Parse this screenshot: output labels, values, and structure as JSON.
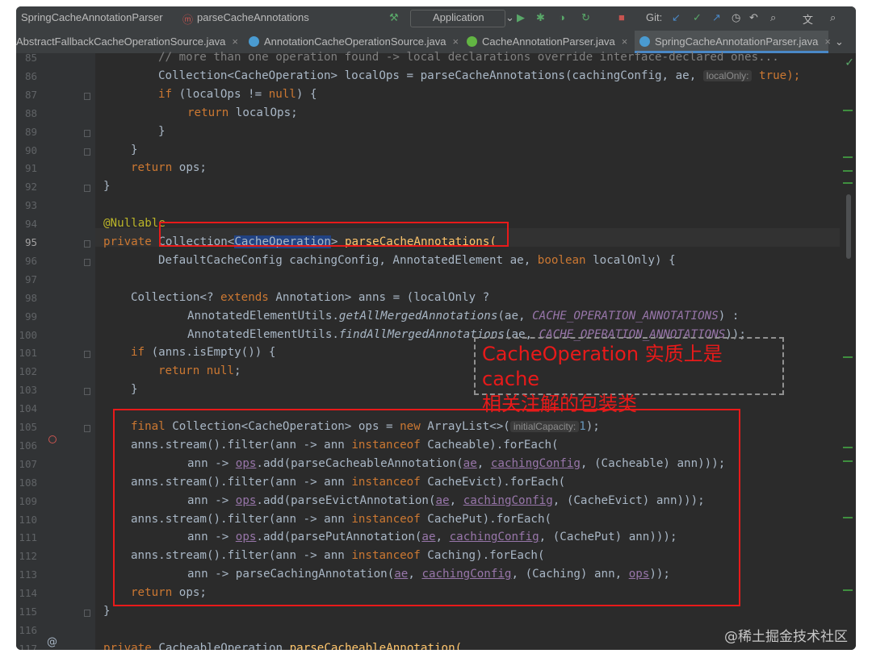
{
  "navbar": {
    "breadcrumb_file": "SpringCacheAnnotationParser",
    "breadcrumb_method": "parseCacheAnnotations",
    "run_config": "Application",
    "git_label": "Git:"
  },
  "tabs": [
    {
      "label": "AbstractFallbackCacheOperationSource.java",
      "close": "×"
    },
    {
      "label": "AnnotationCacheOperationSource.java",
      "close": "×"
    },
    {
      "label": "CacheAnnotationParser.java",
      "close": "×"
    },
    {
      "label": "SpringCacheAnnotationParser.java",
      "close": "×"
    }
  ],
  "line_numbers": [
    "85",
    "86",
    "87",
    "88",
    "89",
    "90",
    "91",
    "92",
    "93",
    "94",
    "95",
    "96",
    "97",
    "98",
    "99",
    "100",
    "101",
    "102",
    "103",
    "104",
    "105",
    "106",
    "107",
    "108",
    "109",
    "110",
    "111",
    "112",
    "113",
    "114",
    "115",
    "116",
    "117"
  ],
  "code": {
    "l85": "// more than one operation found -> local declarations override interface-declared ones...",
    "l86": "Collection<CacheOperation> localOps = parseCacheAnnotations(cachingConfig, ae,",
    "l86_hint": "localOnly:",
    "l86_tail": "true);",
    "l87a": "if",
    "l87b": "(localOps != ",
    "l87c": "null",
    "l87d": ") {",
    "l88a": "return",
    "l88b": " localOps;",
    "l89": "}",
    "l90": "}",
    "l91a": "return",
    "l91b": " ops;",
    "l92": "}",
    "l94": "@Nullable",
    "l95a": "private",
    "l95b": "Collection<",
    "l95c": "CacheOperation",
    "l95d": "> ",
    "l95e": "parseCacheAnnotations(",
    "l96a": "DefaultCacheConfig cachingConfig, AnnotatedElement ae, ",
    "l96b": "boolean",
    "l96c": " localOnly) {",
    "l98a": "Collection<? ",
    "l98b": "extends",
    "l98c": " Annotation> anns = (localOnly ?",
    "l99a": "AnnotatedElementUtils.",
    "l99b": "getAllMergedAnnotations",
    "l99c": "(ae, ",
    "l99d": "CACHE_OPERATION_ANNOTATIONS",
    "l99e": ") :",
    "l100a": "AnnotatedElementUtils.",
    "l100b": "findAllMergedAnnotations",
    "l100c": "(ae, ",
    "l100d": "CACHE_OPERATION_ANNOTATIONS",
    "l100e": "));",
    "l101a": "if",
    "l101b": " (anns.isEmpty()) {",
    "l102a": "return",
    "l102b": "null",
    "l102c": ";",
    "l103": "}",
    "l105a": "final",
    "l105b": " Collection<CacheOperation> ops = ",
    "l105c": "new",
    "l105d": " ArrayList<>(",
    "l105_hint": "initialCapacity:",
    "l105e": "1",
    "l105f": ");",
    "l106a": "anns.stream().filter(ann -> ann ",
    "l106b": "instanceof",
    "l106c": " Cacheable).forEach(",
    "l107a": "ann -> ",
    "l107b": "ops",
    "l107c": ".add(parseCacheableAnnotation(",
    "l107d": "ae",
    "l107e": ", ",
    "l107f": "cachingConfig",
    "l107g": ", (Cacheable) ann)));",
    "l108a": "anns.stream().filter(ann -> ann ",
    "l108b": "instanceof",
    "l108c": " CacheEvict).forEach(",
    "l109a": "ann -> ",
    "l109b": "ops",
    "l109c": ".add(parseEvictAnnotation(",
    "l109d": "ae",
    "l109e": ", ",
    "l109f": "cachingConfig",
    "l109g": ", (CacheEvict) ann)));",
    "l110a": "anns.stream().filter(ann -> ann ",
    "l110b": "instanceof",
    "l110c": " CachePut).forEach(",
    "l111a": "ann -> ",
    "l111b": "ops",
    "l111c": ".add(parsePutAnnotation(",
    "l111d": "ae",
    "l111e": ", ",
    "l111f": "cachingConfig",
    "l111g": ", (CachePut) ann)));",
    "l112a": "anns.stream().filter(ann -> ann ",
    "l112b": "instanceof",
    "l112c": " Caching).forEach(",
    "l113a": "ann -> parseCachingAnnotation(",
    "l113b": "ae",
    "l113c": ", ",
    "l113d": "cachingConfig",
    "l113e": ", (Caching) ann, ",
    "l113f": "ops",
    "l113g": "));",
    "l114a": "return",
    "l114b": " ops;",
    "l115": "}",
    "l117a": "private",
    "l117b": " CacheableOperation ",
    "l117c": "parseCacheableAnnotation("
  },
  "annotation_note": {
    "line1": "CacheOperation 实质上是 cache",
    "line2": "相关注解的包装类"
  },
  "watermark": "@稀土掘金技术社区",
  "colors": {
    "editor_bg": "#2b2b2b",
    "keyword": "#cc7832",
    "method": "#ffc66d",
    "annotation": "#bbb529",
    "constant": "#9876aa",
    "highlight_box": "#e81a1a"
  }
}
